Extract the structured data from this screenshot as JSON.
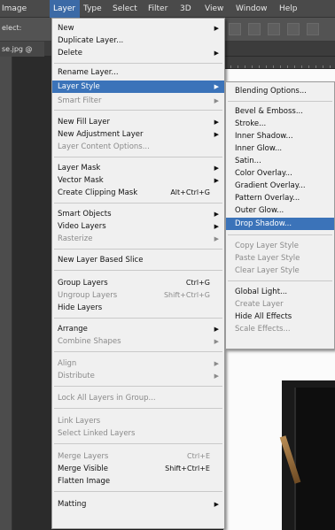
{
  "menubar": {
    "items": [
      {
        "label": "Image"
      },
      {
        "label": "Layer"
      },
      {
        "label": "Type"
      },
      {
        "label": "Select"
      },
      {
        "label": "Filter"
      },
      {
        "label": "3D"
      },
      {
        "label": "View"
      },
      {
        "label": "Window"
      },
      {
        "label": "Help"
      }
    ]
  },
  "optbar": {
    "label": "elect:"
  },
  "document": {
    "tab": "se.jpg @"
  },
  "layer_menu": {
    "items": [
      {
        "label": "New",
        "submenu": true
      },
      {
        "label": "Duplicate Layer..."
      },
      {
        "label": "Delete",
        "submenu": true
      },
      {
        "label": "Rename Layer..."
      },
      {
        "label": "Layer Style",
        "submenu": true,
        "highlighted": true
      },
      {
        "label": "Smart Filter",
        "submenu": true,
        "disabled": true
      },
      {
        "label": "New Fill Layer",
        "submenu": true
      },
      {
        "label": "New Adjustment Layer",
        "submenu": true
      },
      {
        "label": "Layer Content Options...",
        "disabled": true
      },
      {
        "label": "Layer Mask",
        "submenu": true
      },
      {
        "label": "Vector Mask",
        "submenu": true
      },
      {
        "label": "Create Clipping Mask",
        "shortcut": "Alt+Ctrl+G"
      },
      {
        "label": "Smart Objects",
        "submenu": true
      },
      {
        "label": "Video Layers",
        "submenu": true
      },
      {
        "label": "Rasterize",
        "submenu": true,
        "disabled": true
      },
      {
        "label": "New Layer Based Slice"
      },
      {
        "label": "Group Layers",
        "shortcut": "Ctrl+G"
      },
      {
        "label": "Ungroup Layers",
        "shortcut": "Shift+Ctrl+G",
        "disabled": true
      },
      {
        "label": "Hide Layers"
      },
      {
        "label": "Arrange",
        "submenu": true
      },
      {
        "label": "Combine Shapes",
        "submenu": true,
        "disabled": true
      },
      {
        "label": "Align",
        "submenu": true,
        "disabled": true
      },
      {
        "label": "Distribute",
        "submenu": true,
        "disabled": true
      },
      {
        "label": "Lock All Layers in Group...",
        "disabled": true
      },
      {
        "label": "Link Layers",
        "disabled": true
      },
      {
        "label": "Select Linked Layers",
        "disabled": true
      },
      {
        "label": "Merge Layers",
        "shortcut": "Ctrl+E",
        "disabled": true
      },
      {
        "label": "Merge Visible",
        "shortcut": "Shift+Ctrl+E"
      },
      {
        "label": "Flatten Image"
      },
      {
        "label": "Matting",
        "submenu": true
      }
    ]
  },
  "layer_style_submenu": {
    "items": [
      {
        "label": "Blending Options..."
      },
      {
        "label": "Bevel & Emboss..."
      },
      {
        "label": "Stroke..."
      },
      {
        "label": "Inner Shadow..."
      },
      {
        "label": "Inner Glow..."
      },
      {
        "label": "Satin..."
      },
      {
        "label": "Color Overlay..."
      },
      {
        "label": "Gradient Overlay..."
      },
      {
        "label": "Pattern Overlay..."
      },
      {
        "label": "Outer Glow..."
      },
      {
        "label": "Drop Shadow...",
        "highlighted": true
      },
      {
        "label": "Copy Layer Style",
        "disabled": true
      },
      {
        "label": "Paste Layer Style",
        "disabled": true
      },
      {
        "label": "Clear Layer Style",
        "disabled": true
      },
      {
        "label": "Global Light..."
      },
      {
        "label": "Create Layer",
        "disabled": true
      },
      {
        "label": "Hide All Effects"
      },
      {
        "label": "Scale Effects...",
        "disabled": true
      }
    ]
  },
  "colors": {
    "highlight": "#3b73b9",
    "menu_bg": "#f0f0f0",
    "disabled_text": "#8a8a8a"
  }
}
